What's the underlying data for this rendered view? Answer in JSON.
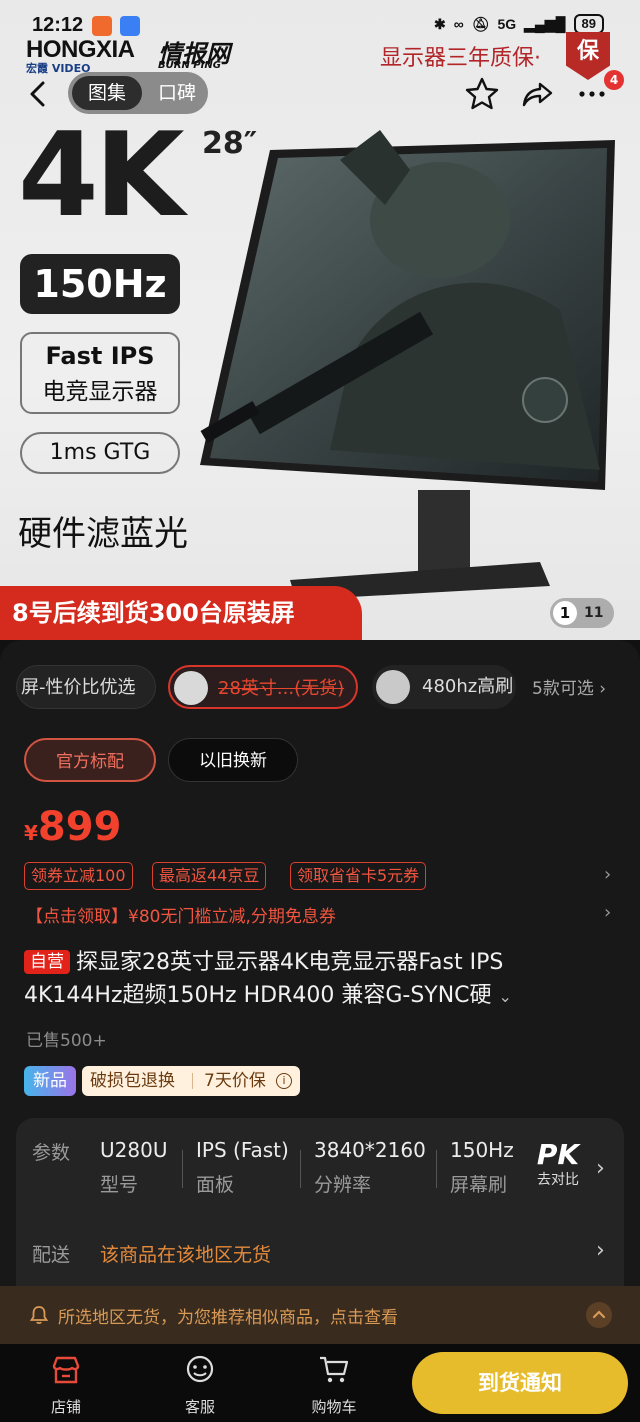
{
  "status_bar": {
    "time": "12:12",
    "network": "5G",
    "battery": "89"
  },
  "hero": {
    "logo_brand": "HONGXIA",
    "logo_brand_sub": "宏霞 VIDEO",
    "logo_channel": "情报网",
    "logo_channel_sub": "BURN PING",
    "guarantee": "显示器三年质保·",
    "guarantee_badge": "保",
    "tabs": [
      "图集",
      "口碑"
    ],
    "more_badge": "4",
    "resolution": "4K",
    "size": "28″",
    "refresh": "150Hz",
    "panel_line1": "Fast IPS",
    "panel_line2": "电竞显示器",
    "gtg": "1ms GTG",
    "filter": "硬件滤蓝光",
    "stock_banner": "8号后续到货300台原装屏",
    "image_index": "1",
    "image_total": "11"
  },
  "variants": {
    "chip1": "屏-性价比优选",
    "chip2": "28英寸...(无货)",
    "chip3": "480hz高刷",
    "more": "5款可选 ›"
  },
  "tags": {
    "official": "官方标配",
    "tradein": "以旧换新"
  },
  "price": {
    "currency": "¥",
    "value": "899"
  },
  "coupons": [
    "领券立减100",
    "最高返44京豆",
    "领取省省卡5元券"
  ],
  "promo": "【点击领取】¥80无门槛立减,分期免息券",
  "product": {
    "self_tag": "自营",
    "title": "探显家28英寸显示器4K电竞显示器Fast IPS 4K144Hz超频150Hz HDR400 兼容G-SYNC硬",
    "sold": "已售500+",
    "badge_new": "新品",
    "service_a": "破损包退换",
    "service_b": "7天价保"
  },
  "specs": {
    "label": "参数",
    "items": [
      {
        "value": "U280U",
        "key": "型号"
      },
      {
        "value": "IPS (Fast)",
        "key": "面板"
      },
      {
        "value": "3840*2160",
        "key": "分辨率"
      },
      {
        "value": "150Hz",
        "key": "屏幕刷"
      }
    ],
    "pk": "PK",
    "pk_label": "去对比",
    "delivery_label": "配送",
    "delivery_value": "该商品在该地区无货"
  },
  "notice": "所选地区无货，为您推荐相似商品，点击查看",
  "bottom_bar": {
    "store": "店铺",
    "service": "客服",
    "cart": "购物车",
    "notify": "到货通知"
  },
  "colors": {
    "accent_red": "#f2412d",
    "notify_yellow": "#e6bb2c",
    "delivery_orange": "#e58a3a"
  }
}
